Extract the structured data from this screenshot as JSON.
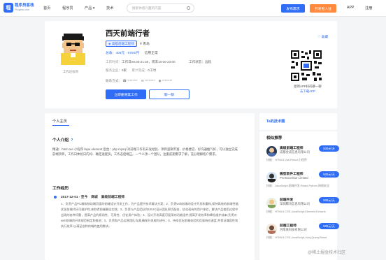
{
  "header": {
    "logo_letter": "程",
    "logo_title": "程序员客栈",
    "logo_sub": "Proginn.com",
    "nav": [
      "首页",
      "程序员",
      "产品",
      "技术"
    ],
    "search_placeholder": "搜索你感兴趣的内容",
    "post_button": "发布需求",
    "dev_button": "开发者入驻",
    "right_links": [
      "APP",
      "注册"
    ]
  },
  "profile": {
    "name": "西天前端行者",
    "badge": "高级前端工程师",
    "city": "青岛",
    "stats": "总收：406元 · 8700/月",
    "credit": "信用正常",
    "work_time_label": "工作时间：",
    "work_time": "工作日08:30-21:30，周末10:00-23:00",
    "work_state_label": "工作状态：",
    "work_state": "远程",
    "experience_label": "服务企业：",
    "experience": "5家",
    "sum_label": "累计完成：",
    "sum": "0工时",
    "contact_label": "联系方式：",
    "contact_values": [
      "********",
      "********",
      "********"
    ],
    "hire_button": "立即雇佣其工作",
    "chat_button": "聊一聊",
    "favorite": "收藏",
    "avatar_caption": "工作达标项",
    "qr_caption": "使用APP扫码聊一聊",
    "qr_link": "去下载APP"
  },
  "main": {
    "tab": "个人主页",
    "intro_title": "个人介绍",
    "intro_text": "精通：html vue 小程序 layui element 后台：php mysql 对前端工作有开发经验、项目逻辑丰富、价格便宜、好沟通推气好，可以独立完成前端项目，工作日体验日内均、确定速度快，工作态度端正。一个人顶一个团队，注重前期需求了解，充分理解客户需求。",
    "work_title": "工作经历",
    "job_header": "2017-12-01 - 至今　商城　高级前端工程师",
    "job_text": "1、负责产品PC端和移动端页面的前端设计开发工作，为产品提供技术解决方案；2、负责web前端的设计开发和重构,保持高效的前端性能,优化前端代码可维护性,来取得前端最佳实践；3、负责与产品团队和UI/UX设计团队密切配合，优化现有的用户体验，解决产品使用过程中出现的各种问题，提高产品的易用性、可用性、优化用户体验；4、设计开发高度可复用的功能组件,提高开发效率和降低维护成本;负责对web前端的开发规范制定和推进；5、负责和产品运营团队沟通,确保开发顺利进行；6、持续优化前端体验和页面响应速度,并保证兼容性和执行效率,以满足各种终端的使用需求。"
  },
  "sidebar": {
    "title": "Ta的技术圈",
    "heading": "相似推荐",
    "developers": [
      {
        "name": "高级前端工程师",
        "company": "成都金成信息有限公司",
        "skills": "技能：HTML5,Vue,React,小程序",
        "price": "500元/天"
      },
      {
        "name": "微型软件工程师",
        "company": "Pro-Excelsior Limited",
        "skills": "技能：JavaScript,前端开发,React,Python,网络安全",
        "price": "500元/天"
      },
      {
        "name": "前端开发",
        "company": "深圳腾讯信息有限公司",
        "skills": "技能：HTML5,CSS,JavaScript,Element,Echarts",
        "price": "500元/天"
      },
      {
        "name": "前端工程师",
        "company": "河南某科技有限公司",
        "skills": "技能：HTML5,CSS,JavaScript,Vue,jQuery,React",
        "price": "500元/天"
      }
    ]
  },
  "watermark": "@稀土掘金技术社区"
}
